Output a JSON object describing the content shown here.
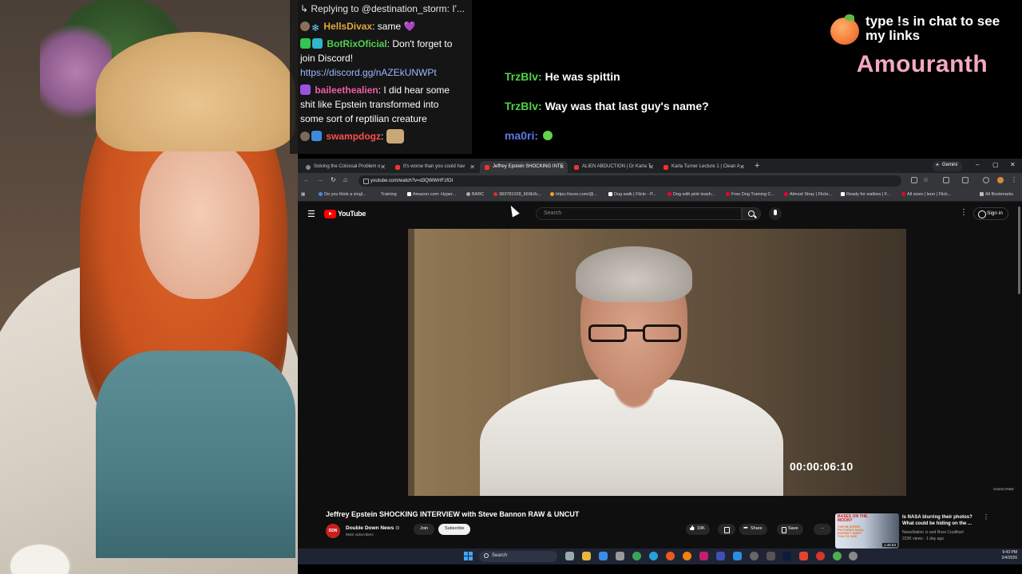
{
  "overlay_chat": {
    "reply_prefix": "Replying to @destination_storm: I'...",
    "messages": [
      {
        "user": "HellsDivax",
        "text": "same",
        "emote": "purple-heart"
      },
      {
        "user": "BotRixOficial",
        "text": "Don't forget to join Discord!",
        "link": "https://discord.gg/nAZEkUNWPt"
      },
      {
        "user": "baileethealien",
        "text": "I did hear some shit like Epstein transformed into some sort of reptilian creature"
      },
      {
        "user": "swampdogz",
        "text": "",
        "emote": "cat-sunglasses"
      }
    ]
  },
  "stream_chat": [
    {
      "user": "TrzBlv:",
      "text": "He was spittin"
    },
    {
      "user": "TrzBlv:",
      "text": "Way was that last guy's name?"
    },
    {
      "user": "ma0ri:",
      "text": "",
      "emote": "frog"
    }
  ],
  "branding": {
    "cta": "type !s in chat to see my links",
    "streamer": "Amouranth"
  },
  "browser": {
    "tabs": [
      {
        "title": "Solving the Colossal Problem o",
        "active": false
      },
      {
        "title": "It's worse than you could hav",
        "active": false
      },
      {
        "title": "Jeffrey Epstein SHOCKING INTE",
        "active": true
      },
      {
        "title": "ALIEN ABDUCTION | Dr Karla T",
        "active": false
      },
      {
        "title": "Karla Turner Lecture 1 | Clean A",
        "active": false
      }
    ],
    "new_tab": "+",
    "gemini": "Gemini",
    "window_controls": [
      "–",
      "▢",
      "✕"
    ],
    "url": "youtube.com/watch?v=d3QWWHFzfOI",
    "bookmarks": [
      "Do you think a singl...",
      "Training",
      "Amazon.com: Hyper...",
      "BARC",
      "383781028_669b3c...",
      "https://suno.com/@...",
      "Dog walk | Flickr - P...",
      "Dog with pink leash...",
      "Free Dog Training C...",
      "Almost Stray | Flickr...",
      "Ready for walkies | F...",
      "All sizes | leon | Flick...",
      "All Bookmarks"
    ]
  },
  "youtube": {
    "logo": "YouTube",
    "search_placeholder": "Search",
    "sign_in": "Sign in",
    "timecode": "00:00:06:10",
    "subscribe_watermark": "SUBSCRIBE",
    "video_title": "Jeffrey Epstein SHOCKING INTERVIEW with Steve Bannon RAW & UNCUT",
    "channel": {
      "name": "Double Down News",
      "subs": "965K subscribers",
      "avatar": "DDN"
    },
    "join": "Join",
    "subscribe": "Subscribe",
    "likes": "19K",
    "share": "Share",
    "save": "Save",
    "more": "···",
    "recommendation": {
      "thumb_text_1": "BASES ON THE MOON?",
      "thumb_text_2": "THE BLURRED PICTURES NASA DOESN'T WANT YOU TO SEE",
      "duration": "1:46:53",
      "title": "Is NASA blurring their photos? What could be hiding on the ...",
      "channel": "NewsNation ⊙ and Ross Coulthart",
      "meta": "223K views · 1 day ago"
    }
  },
  "taskbar": {
    "search": "Search",
    "time": "9:43 PM",
    "date": "2/4/2026"
  }
}
